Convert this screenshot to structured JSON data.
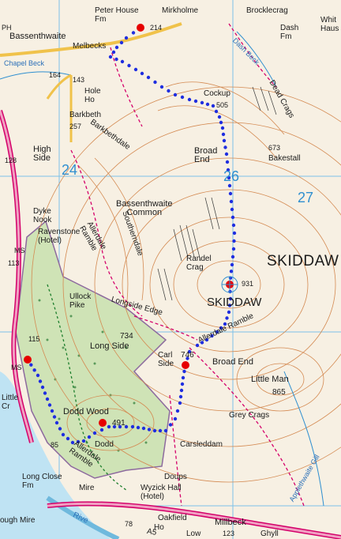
{
  "map": {
    "labels": {
      "peter_house_fm": "Peter House\nFm",
      "mirkholme": "Mirkholme",
      "brocklecrag": "Brocklecrag",
      "white_haus": "Whit\nHaus",
      "dash_fm": "Dash\nFm",
      "bassenthwaite_village": "Bassenthwaite",
      "ph": "PH",
      "melbecks": "Melbecks",
      "chapel_beck": "Chapel Beck",
      "dash_beck": "Dash Beck",
      "hole_ho": "Hole\nHo",
      "barkbeth": "Barkbeth",
      "barkbethdale": "Barkbethdale",
      "cockup": "Cockup",
      "dead_crags": "Dead Crags",
      "bakestall": "Bakestall",
      "broad_end_north": "Broad\nEnd",
      "high_side": "High\nSide",
      "bassenthwaite_common": "Bassenthwaite\nCommon",
      "dyke_nook": "Dyke\nNook",
      "ravenstone_hotel": "Ravenstone\n(Hotel)",
      "southerndale": "Southerndale",
      "allerdale_ramble_north": "Allerdale\nRamble",
      "randel_crag": "Randel\nCrag",
      "skiddaw_area": "SKIDDAW",
      "skiddaw_summit": "SKIDDAW",
      "ullock_pike": "Ullock\nPike",
      "longside_edge": "Longside  Edge",
      "long_side": "Long Side",
      "carl_side": "Carl\nSide",
      "broad_end_south": "Broad End",
      "little_man": "Little Man",
      "allerdale_ramble_mid": "Allerdale Ramble",
      "grey_crags": "Grey Crags",
      "dodd_wood": "Dodd Wood",
      "dodd": "Dodd",
      "allerdale_ramble_south": "Allerdale\nRamble",
      "carsleddam": "Carsleddam",
      "little_crosthwaite": "Little\nCr",
      "long_close_fm": "Long Close\nFm",
      "doups": "Doups",
      "mirehouse": "Mire",
      "ough_mire": "ough Mire",
      "oakfield": "Oakfield",
      "ho": "Ho",
      "millbeck": "Millbeck",
      "low": "Low",
      "ghyll": "Ghyll",
      "applethwaite_gill": "Applethwaite Gill",
      "ms_west": "MS",
      "ms_south": "MS",
      "a591": "A5",
      "river": "Rive",
      "wyzick_hall": "Wyzick Hall\n(Hotel)"
    },
    "heights": {
      "h214": "214",
      "h164": "164",
      "h143": "143",
      "h257": "257",
      "h505": "505",
      "h673": "673",
      "h128": "128",
      "h113": "113",
      "h931": "931",
      "h734": "734",
      "h746": "746",
      "h865": "865",
      "h115": "115",
      "h491": "491",
      "h85": "85",
      "h78": "78",
      "h123": "123"
    },
    "grid_numbers": {
      "g24": "24",
      "g26": "26",
      "g27": "27"
    },
    "colors": {
      "background": "#f7f0e3",
      "contour": "#d48a52",
      "forest": "#cfe3b6",
      "water": "#bfe3f3",
      "route_blue": "#1f2ee0",
      "waypoint_red": "#e60000",
      "footpath": "#d4006a",
      "road_major": "#d4006a",
      "road_minor": "#f0c24a",
      "grid": "#7cc1e8"
    }
  }
}
